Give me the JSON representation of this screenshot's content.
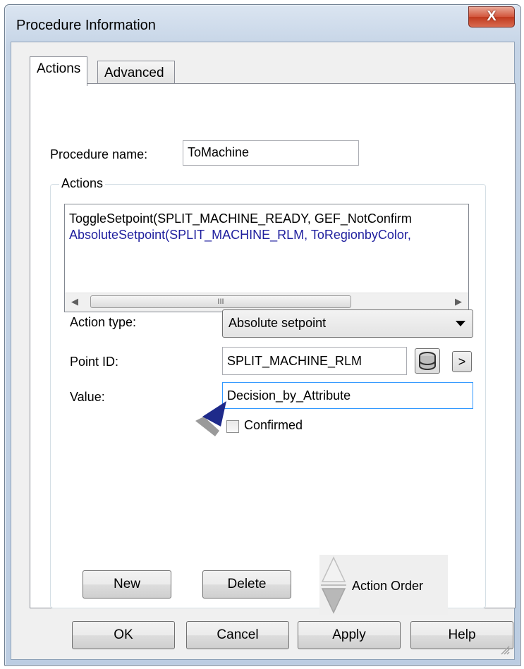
{
  "window": {
    "title": "Procedure Information",
    "close_glyph": "X"
  },
  "tabs": [
    {
      "label": "Actions"
    },
    {
      "label": "Advanced"
    }
  ],
  "procedure": {
    "name_label": "Procedure name:",
    "name_value": "ToMachine"
  },
  "actions_group": {
    "title": "Actions",
    "list_items": [
      {
        "text": "ToggleSetpoint(SPLIT_MACHINE_READY, GEF_NotConfirm",
        "color": "#000000"
      },
      {
        "text": "AbsoluteSetpoint(SPLIT_MACHINE_RLM, ToRegionbyColor,",
        "color": "#1f1f9e"
      }
    ],
    "scrollbar": {
      "left_glyph": "◀",
      "right_glyph": "▶",
      "thumb_glyph": "III"
    }
  },
  "action_type": {
    "label": "Action type:",
    "value": "Absolute setpoint"
  },
  "point_id": {
    "label": "Point ID:",
    "value": "SPLIT_MACHINE_RLM",
    "next_glyph": ">"
  },
  "value": {
    "label": "Value:",
    "value": "Decision_by_Attribute"
  },
  "confirmed": {
    "label": "Confirmed",
    "checked": false
  },
  "group_buttons": {
    "new_label": "New",
    "delete_label": "Delete",
    "order_label": "Action Order",
    "order_mnemonic": "O"
  },
  "dialog_buttons": {
    "ok_label": "OK",
    "cancel_label": "Cancel",
    "apply_label": "Apply",
    "help_label": "Help"
  },
  "colors": {
    "selected_item": "#1f1f9e",
    "focus_border": "#3399ff",
    "annotation_arrow": "#1e2a8a"
  }
}
